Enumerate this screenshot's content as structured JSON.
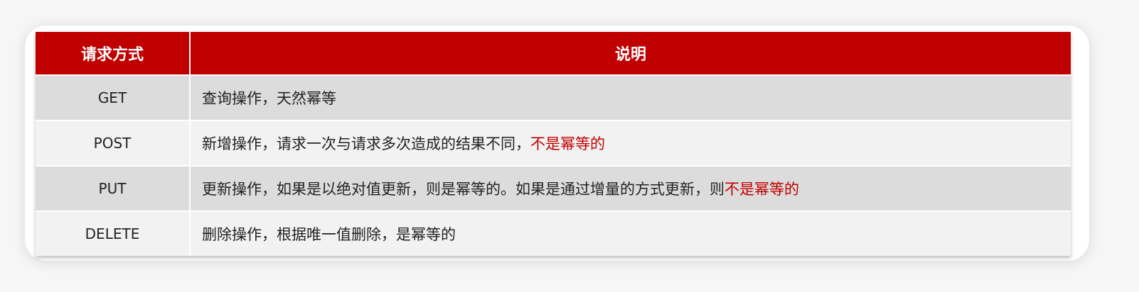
{
  "table": {
    "headers": [
      "请求方式",
      "说明"
    ],
    "rows": [
      {
        "method": "GET",
        "desc": "查询操作，天然幂等",
        "highlight": ""
      },
      {
        "method": "POST",
        "desc": "新增操作，请求一次与请求多次造成的结果不同，",
        "highlight": "不是幂等的"
      },
      {
        "method": "PUT",
        "desc": "更新操作，如果是以绝对值更新，则是幂等的。如果是通过增量的方式更新，则",
        "highlight": "不是幂等的"
      },
      {
        "method": "DELETE",
        "desc": "删除操作，根据唯一值删除，是幂等的",
        "highlight": ""
      }
    ]
  },
  "colors": {
    "header_bg": "#c00000",
    "highlight": "#c00000",
    "row_odd": "#dcdcdc",
    "row_even": "#f2f2f2"
  }
}
